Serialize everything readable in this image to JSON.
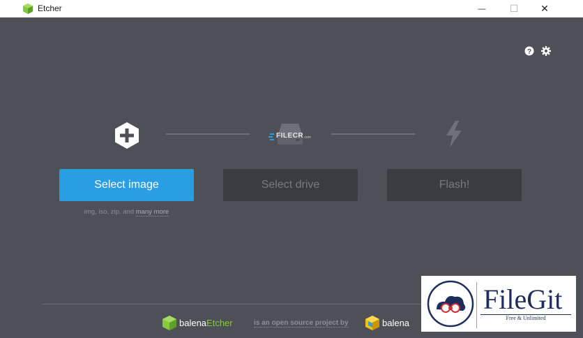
{
  "window": {
    "title": "Etcher",
    "controls": {
      "minimize": "—",
      "maximize": "☐",
      "close": "✕"
    }
  },
  "header_icons": [
    "help-icon",
    "settings-icon"
  ],
  "steps": [
    {
      "icon": "plus-hexagon-icon",
      "button": "Select image",
      "state": "active"
    },
    {
      "icon": "drive-icon",
      "button": "Select drive",
      "state": "disabled"
    },
    {
      "icon": "flash-icon",
      "button": "Flash!",
      "state": "disabled"
    }
  ],
  "image_hint": {
    "prefix": "img, iso, zip, and ",
    "link": "many more"
  },
  "footer": {
    "brand_light": "balena",
    "brand_accent": "Etcher",
    "middle": "is an open source project by",
    "org": "balena"
  },
  "watermarks": {
    "filecr": {
      "name": "FILECR",
      "suffix": ".com"
    },
    "filegit": {
      "name": "FileGit",
      "tagline": "Free & Unlimited"
    }
  },
  "colors": {
    "background": "#4d5057",
    "primary": "#2a9ee3",
    "disabled": "#3a3c42",
    "accent_green": "#85c940",
    "balena_yellow": "#f8c200"
  }
}
